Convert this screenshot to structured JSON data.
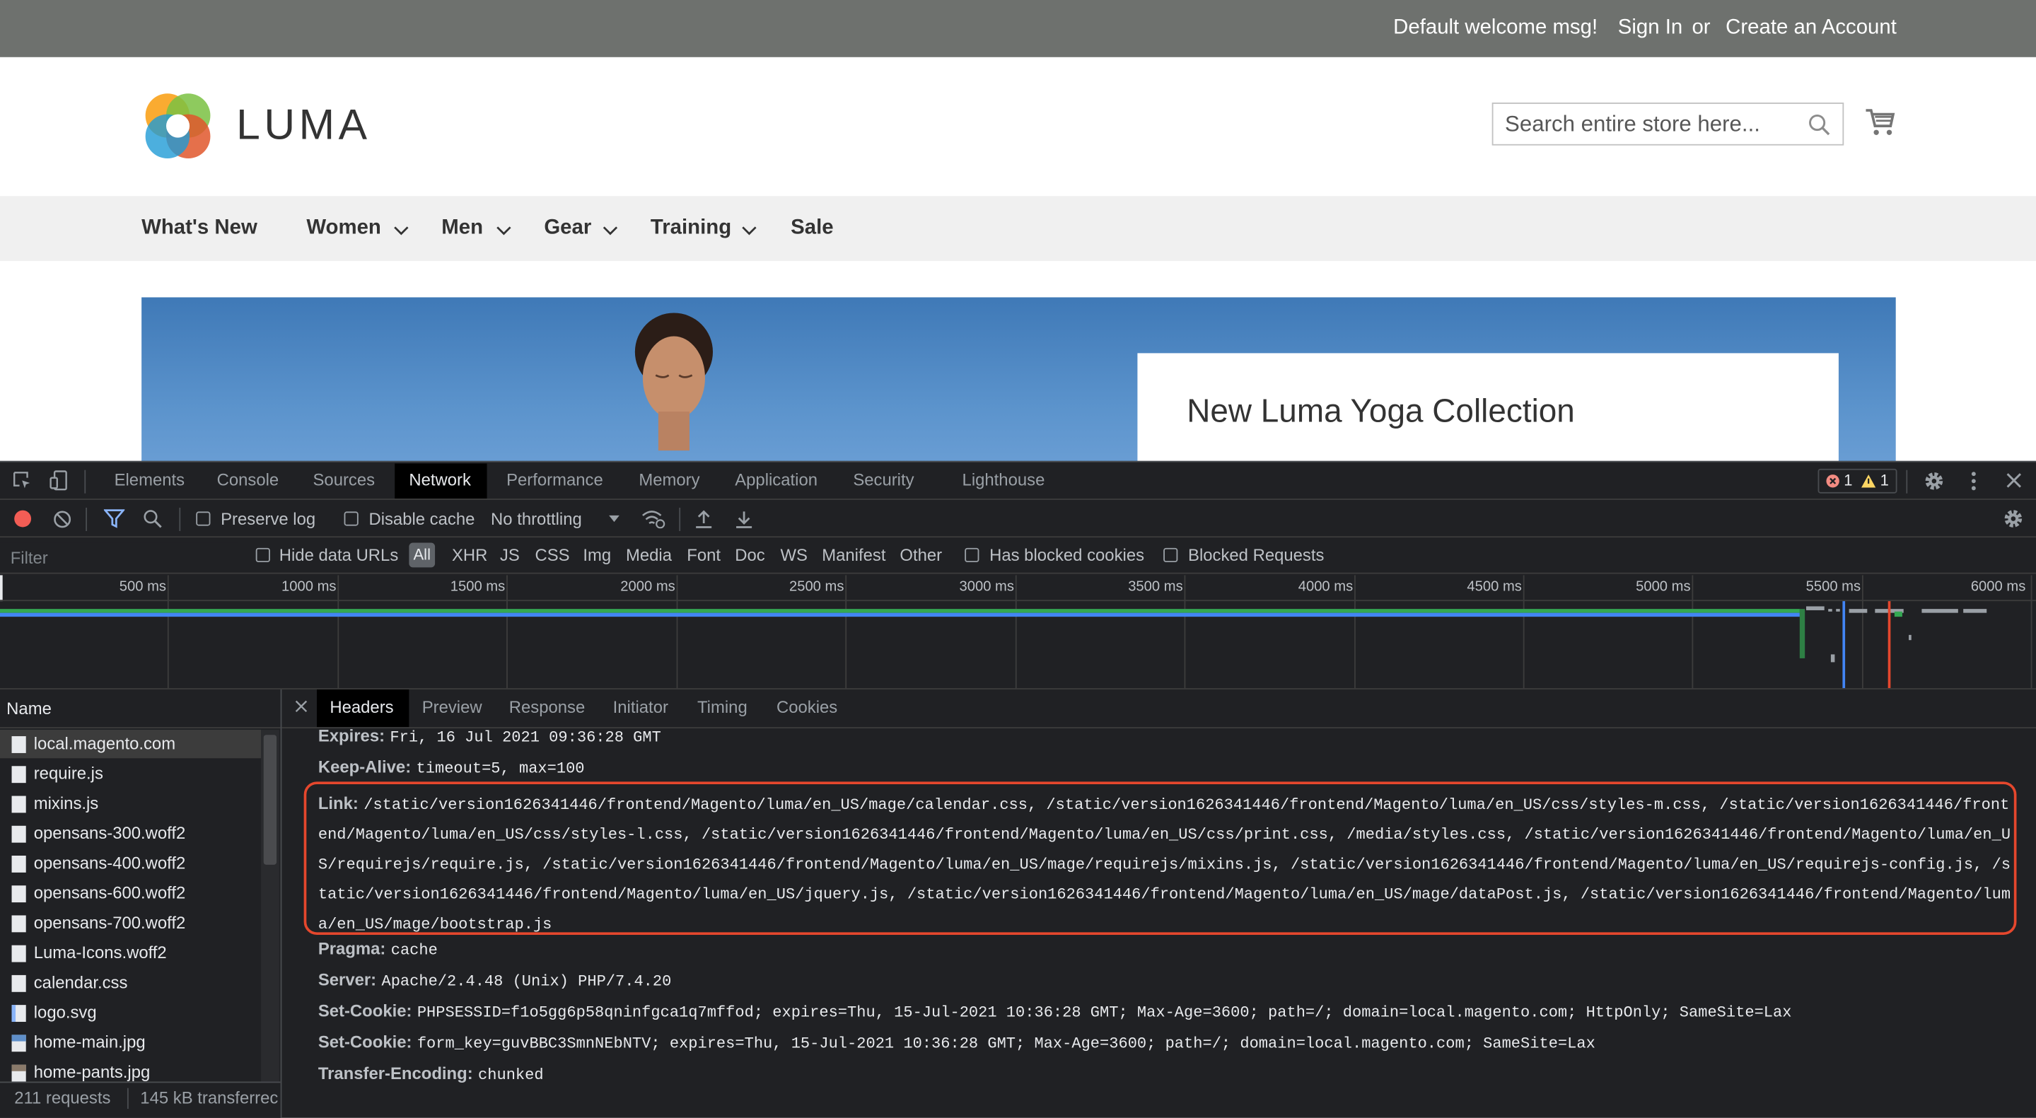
{
  "store": {
    "welcome": "Default welcome msg!",
    "sign_in": "Sign In",
    "or": "or",
    "create_account": "Create an Account",
    "logo_text": "LUMA",
    "search_placeholder": "Search entire store here...",
    "nav": [
      "What's New",
      "Women",
      "Men",
      "Gear",
      "Training",
      "Sale"
    ],
    "hero_title": "New Luma Yoga Collection"
  },
  "devtools": {
    "tabs": [
      "Elements",
      "Console",
      "Sources",
      "Network",
      "Performance",
      "Memory",
      "Application",
      "Security",
      "Lighthouse"
    ],
    "active_tab": "Network",
    "error_count": "1",
    "warning_count": "1",
    "toolbar": {
      "preserve_log": "Preserve log",
      "disable_cache": "Disable cache",
      "throttling": "No throttling"
    },
    "filter": {
      "placeholder": "Filter",
      "hide_data_urls": "Hide data URLs",
      "types": [
        "All",
        "XHR",
        "JS",
        "CSS",
        "Img",
        "Media",
        "Font",
        "Doc",
        "WS",
        "Manifest",
        "Other"
      ],
      "has_blocked_cookies": "Has blocked cookies",
      "blocked_requests": "Blocked Requests"
    },
    "timeline_ticks": [
      "500 ms",
      "1000 ms",
      "1500 ms",
      "2000 ms",
      "2500 ms",
      "3000 ms",
      "3500 ms",
      "4000 ms",
      "4500 ms",
      "5000 ms",
      "5500 ms",
      "6000 ms"
    ],
    "name_header": "Name",
    "requests": [
      "local.magento.com",
      "require.js",
      "mixins.js",
      "opensans-300.woff2",
      "opensans-400.woff2",
      "opensans-600.woff2",
      "opensans-700.woff2",
      "Luma-Icons.woff2",
      "calendar.css",
      "logo.svg",
      "home-main.jpg",
      "home-pants.jpg"
    ],
    "detail_tabs": [
      "Headers",
      "Preview",
      "Response",
      "Initiator",
      "Timing",
      "Cookies"
    ],
    "active_detail_tab": "Headers",
    "headers": {
      "expires_name": "Expires:",
      "expires_value": "Fri, 16 Jul 2021 09:36:28 GMT",
      "keepalive_name": "Keep-Alive:",
      "keepalive_value": "timeout=5, max=100",
      "link_name": "Link:",
      "link_value": "/static/version1626341446/frontend/Magento/luma/en_US/mage/calendar.css, /static/version1626341446/frontend/Magento/luma/en_US/css/styles-m.css, /static/version1626341446/frontend/Magento/luma/en_US/css/styles-l.css, /static/version1626341446/frontend/Magento/luma/en_US/css/print.css, /media/styles.css, /static/version1626341446/frontend/Magento/luma/en_US/requirejs/require.js, /static/version1626341446/frontend/Magento/luma/en_US/mage/requirejs/mixins.js, /static/version1626341446/frontend/Magento/luma/en_US/requirejs-config.js, /static/version1626341446/frontend/Magento/luma/en_US/jquery.js, /static/version1626341446/frontend/Magento/luma/en_US/mage/dataPost.js, /static/version1626341446/frontend/Magento/luma/en_US/mage/bootstrap.js",
      "pragma_name": "Pragma:",
      "pragma_value": "cache",
      "server_name": "Server:",
      "server_value": "Apache/2.4.48 (Unix) PHP/7.4.20",
      "setcookie1_name": "Set-Cookie:",
      "setcookie1_value": "PHPSESSID=f1o5gg6p58qninfgca1q7mffod; expires=Thu, 15-Jul-2021 10:36:28 GMT; Max-Age=3600; path=/; domain=local.magento.com; HttpOnly; SameSite=Lax",
      "setcookie2_name": "Set-Cookie:",
      "setcookie2_value": "form_key=guvBBC3SmnNEbNTV; expires=Thu, 15-Jul-2021 10:36:28 GMT; Max-Age=3600; path=/; domain=local.magento.com; SameSite=Lax",
      "transfer_name": "Transfer-Encoding:",
      "transfer_value": "chunked"
    },
    "status": {
      "requests": "211 requests",
      "transferred": "145 kB transferrec"
    },
    "colors": {
      "highlight_box": "#e5472d",
      "record": "#f25d55",
      "accent": "#8ab4f8"
    }
  }
}
